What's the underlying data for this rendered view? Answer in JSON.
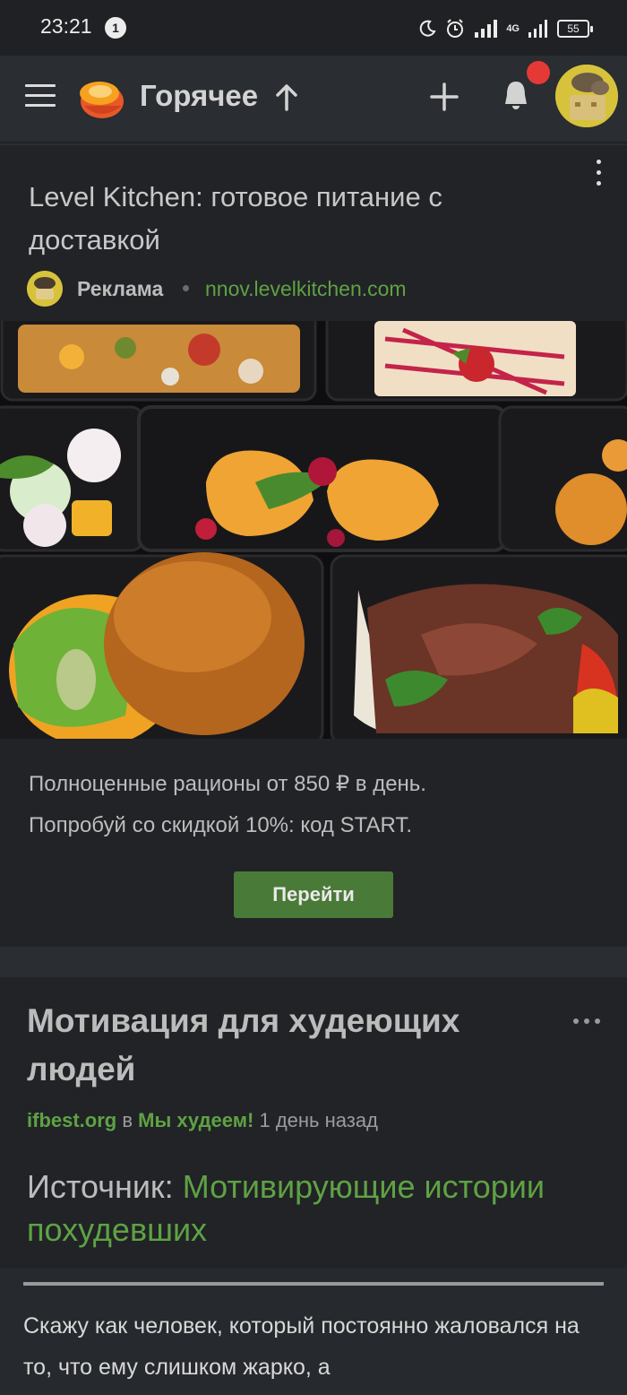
{
  "status_bar": {
    "time": "23:21",
    "notification_count": "1",
    "network_label": "4G",
    "battery": "55",
    "icons": [
      "moon-icon",
      "alarm-icon",
      "signal-icon",
      "signal-4g-icon",
      "battery-icon"
    ]
  },
  "app_bar": {
    "title": "Горячее",
    "icons": [
      "menu-icon",
      "logo-icon",
      "sort-arrow-up-icon",
      "plus-icon",
      "bell-icon",
      "avatar"
    ],
    "notification_dot_color": "#e53935"
  },
  "ad": {
    "title": "Level Kitchen: готовое питание с доставкой",
    "label": "Реклама",
    "domain": "nnov.levelkitchen.com",
    "description_line1": "Полноценные рационы от 850 ₽ в день.",
    "description_line2": "Попробуй со скидкой 10%: код START.",
    "button_label": "Перейти",
    "accent_color": "#4a7a37"
  },
  "post": {
    "title": "Мотивация для худеющих людей",
    "author": "ifbest.org",
    "in_word": "в",
    "community": "Мы худеем!",
    "time_ago": "1 день назад",
    "source_label": "Источник:",
    "source_link": "Мотивирующие истории похудевших",
    "body": "Скажу как человек, который постоянно жаловался на то, что ему слишком жарко, а"
  },
  "colors": {
    "background": "#2a2d31",
    "card": "#212327",
    "link_green": "#5fa243"
  }
}
